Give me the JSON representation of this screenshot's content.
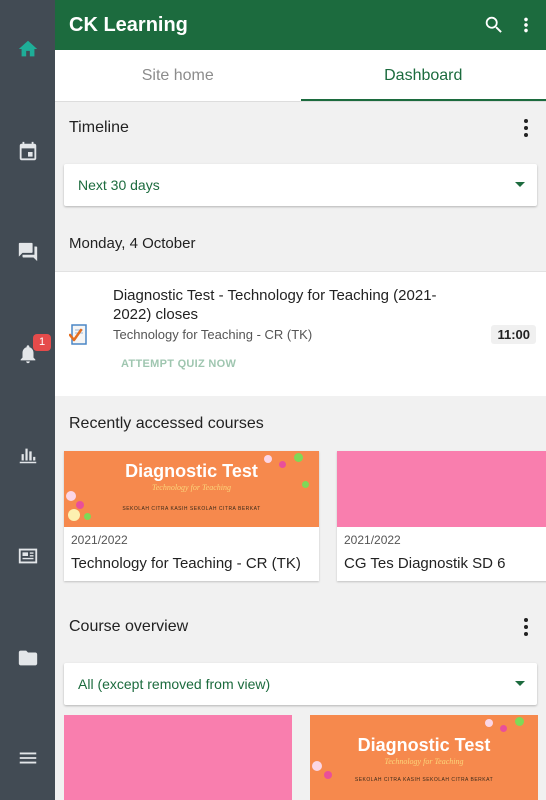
{
  "app": {
    "title": "CK Learning",
    "accent": "#1c6b3e",
    "rail_color": "#424b54"
  },
  "rail": {
    "items": [
      {
        "name": "home-icon",
        "active": true
      },
      {
        "name": "calendar-icon"
      },
      {
        "name": "messages-icon"
      },
      {
        "name": "notifications-icon",
        "badge": "1"
      },
      {
        "name": "grades-icon"
      },
      {
        "name": "news-icon"
      },
      {
        "name": "folder-icon"
      },
      {
        "name": "menu-icon"
      }
    ]
  },
  "tabs": [
    {
      "label": "Site home",
      "active": false
    },
    {
      "label": "Dashboard",
      "active": true
    }
  ],
  "timeline": {
    "heading": "Timeline",
    "filter": "Next 30 days",
    "day": "Monday, 4 October",
    "event": {
      "title": "Diagnostic Test - Technology for Teaching (2021-2022) closes",
      "course": "Technology for Teaching - CR (TK)",
      "time": "11:00",
      "action": "ATTEMPT QUIZ NOW"
    }
  },
  "recent": {
    "heading": "Recently accessed courses",
    "courses": [
      {
        "year": "2021/2022",
        "name": "Technology for Teaching - CR (TK)",
        "banner_title": "Diagnostic Test",
        "banner_sub": "Technology for Teaching",
        "banner_logos": "SEKOLAH CITRA KASIH   SEKOLAH CITRA BERKAT"
      },
      {
        "year": "2021/2022",
        "name": "CG Tes Diagnostik SD 6"
      }
    ]
  },
  "overview": {
    "heading": "Course overview",
    "filter": "All (except removed from view)",
    "cards": [
      {
        "banner_title": ""
      },
      {
        "banner_title": "Diagnostic Test",
        "banner_sub": "Technology for Teaching",
        "banner_logos": "SEKOLAH CITRA KASIH   SEKOLAH CITRA BERKAT"
      }
    ]
  }
}
